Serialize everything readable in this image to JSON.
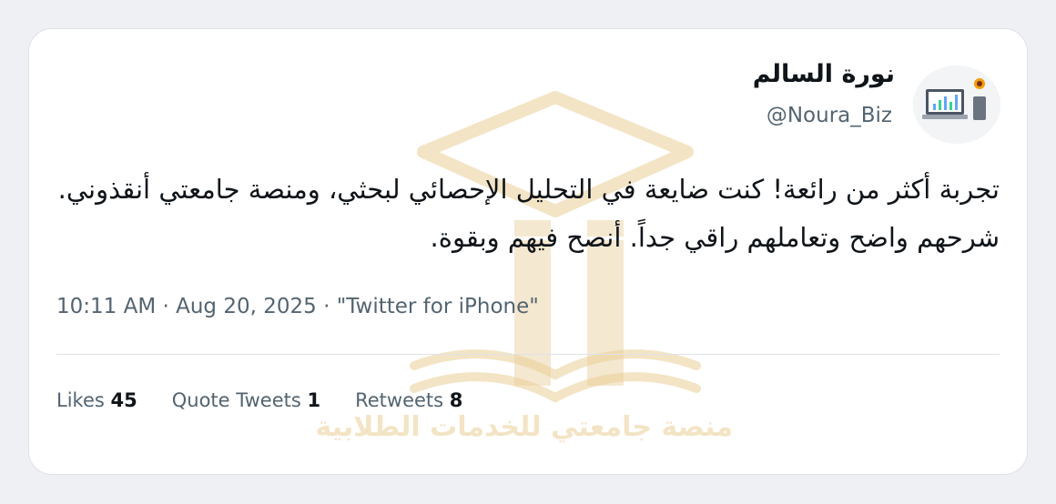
{
  "author": {
    "name": "نورة السالم",
    "handle": "@Noura_Biz"
  },
  "tweet": {
    "text": "تجربة أكثر من رائعة! كنت ضايعة في التحليل الإحصائي لبحثي، ومنصة جامعتي أنقذوني. شرحهم واضح وتعاملهم راقي جداً. أنصح فيهم وبقوة."
  },
  "meta": {
    "time": "10:11 AM",
    "date": "Aug 20, 2025",
    "source": "\"Twitter for iPhone\""
  },
  "stats": {
    "likes_label": "Likes",
    "likes_count": "45",
    "quotes_label": "Quote Tweets",
    "quotes_count": "1",
    "retweets_label": "Retweets",
    "retweets_count": "8"
  },
  "watermark": {
    "text": "منصة جامعتي للخدمات الطلابية",
    "color": "#e9cd96"
  },
  "colors": {
    "background": "#eef0f4",
    "card": "#ffffff",
    "primary_text": "#0f1419",
    "secondary_text": "#536471",
    "divider": "#dfe2e8"
  }
}
